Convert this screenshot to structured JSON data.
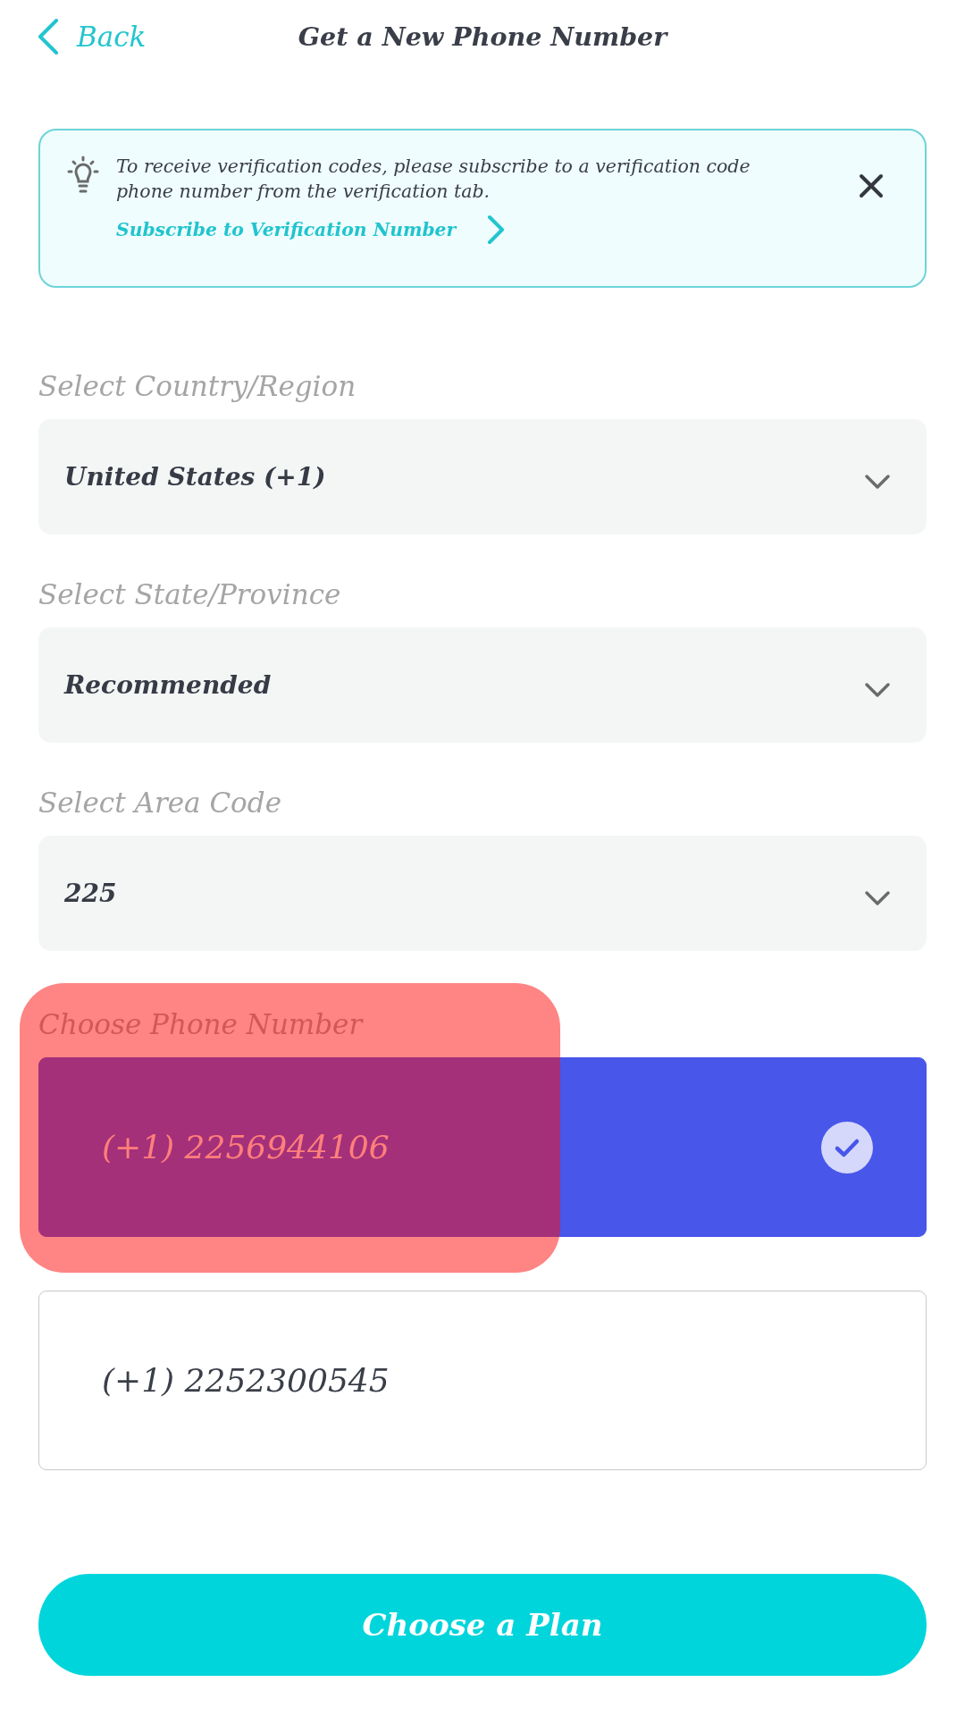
{
  "header": {
    "back_label": "Back",
    "title": "Get a New Phone Number"
  },
  "notice": {
    "message": "To receive verification codes, please subscribe to a verification code phone number from the verification tab.",
    "link": "Subscribe to Verification Number"
  },
  "selects": [
    {
      "label": "Select Country/Region",
      "value": "United States (+1)"
    },
    {
      "label": "Select State/Province",
      "value": "Recommended"
    },
    {
      "label": "Select Area Code",
      "value": "225"
    }
  ],
  "phone_numbers": {
    "label": "Choose Phone Number",
    "options": [
      {
        "number": "(+1) 2256944106",
        "selected": true
      },
      {
        "number": "(+1) 2252300545",
        "selected": false
      }
    ]
  },
  "primary_button": {
    "label": "Choose a Plan"
  }
}
